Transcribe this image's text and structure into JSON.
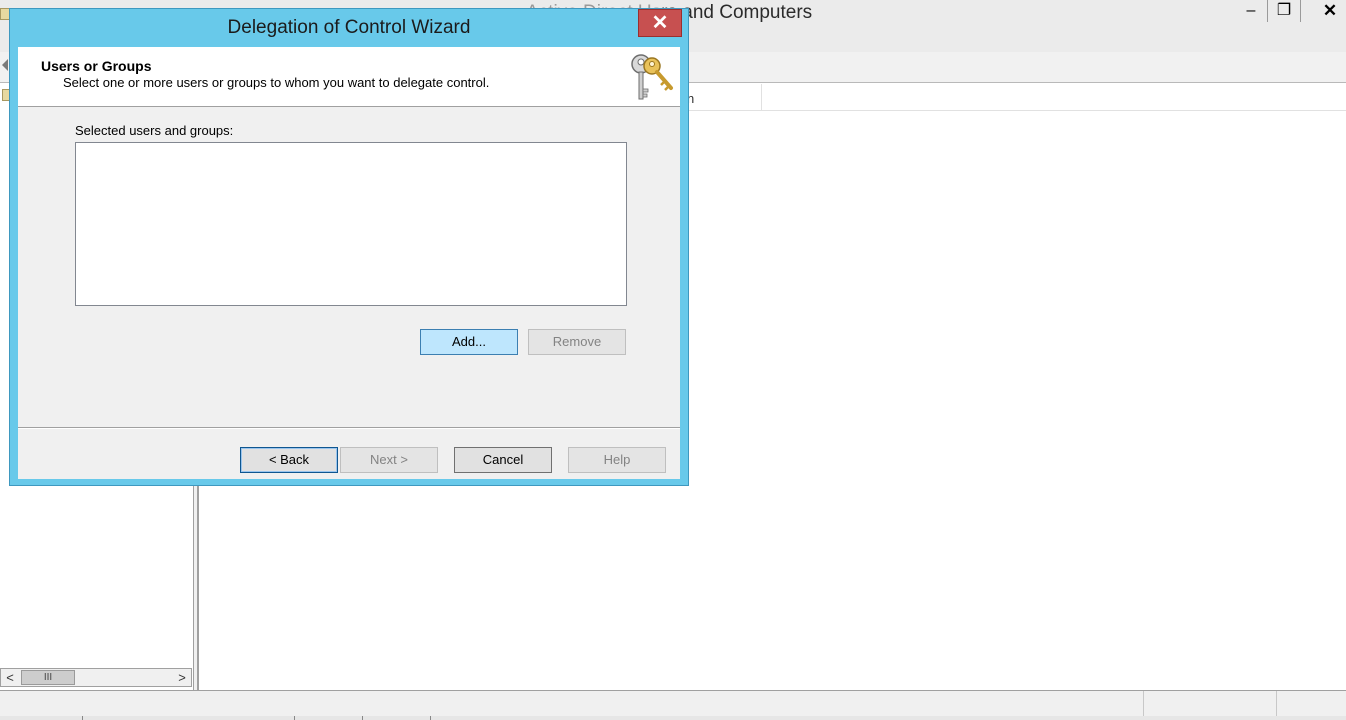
{
  "background_window": {
    "title": "Active Directory Users and Computers",
    "title_visible_part": "rs and Computers",
    "title_obscured_part": "Active Direct Us",
    "column_header_fragment": "n",
    "scrollbar_thumb_glyph": "III",
    "scroll_left_glyph": "<",
    "scroll_right_glyph": ">",
    "minimize_glyph": "–",
    "restore_glyph": "❐",
    "close_glyph": "✕"
  },
  "dialog": {
    "title": "Delegation of Control Wizard",
    "close_glyph": "✕",
    "header_title": "Users or Groups",
    "header_subtitle": "Select one or more users or groups to whom you want to delegate control.",
    "header_icon": "keys-icon",
    "list_label": "Selected users and groups:",
    "list_items": [],
    "buttons": {
      "add": "Add...",
      "remove": "Remove",
      "back": "< Back",
      "next": "Next >",
      "cancel": "Cancel",
      "help": "Help"
    }
  },
  "colors": {
    "dialog_frame": "#68c9ea",
    "close_button": "#c75050",
    "add_button_hover": "#bee6fd"
  }
}
